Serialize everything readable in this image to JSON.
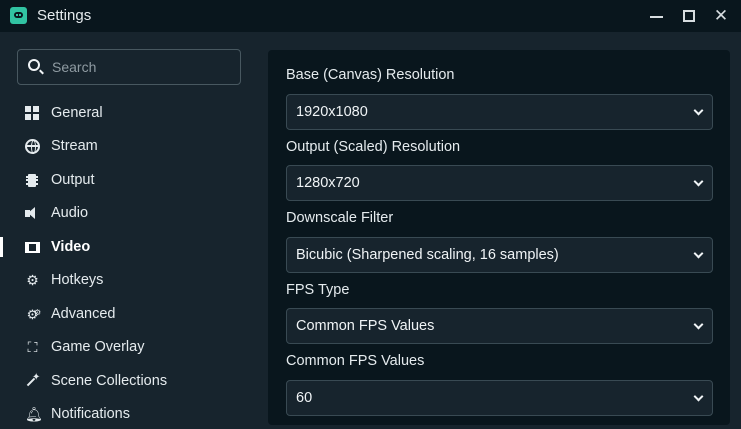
{
  "window": {
    "title": "Settings",
    "app_icon": "streamlabs-icon",
    "controls": [
      "minimize-icon",
      "maximize-icon",
      "close-icon"
    ]
  },
  "sidebar": {
    "search": {
      "placeholder": "Search",
      "value": ""
    },
    "items": [
      {
        "label": "General",
        "icon": "grid-icon",
        "active": false
      },
      {
        "label": "Stream",
        "icon": "globe-icon",
        "active": false
      },
      {
        "label": "Output",
        "icon": "chip-icon",
        "active": false
      },
      {
        "label": "Audio",
        "icon": "speaker-icon",
        "active": false
      },
      {
        "label": "Video",
        "icon": "film-icon",
        "active": true
      },
      {
        "label": "Hotkeys",
        "icon": "gear-icon",
        "active": false
      },
      {
        "label": "Advanced",
        "icon": "gears-icon",
        "active": false
      },
      {
        "label": "Game Overlay",
        "icon": "overlay-icon",
        "active": false
      },
      {
        "label": "Scene Collections",
        "icon": "wand-icon",
        "active": false
      },
      {
        "label": "Notifications",
        "icon": "bell-icon",
        "active": false
      }
    ]
  },
  "video": {
    "fields": [
      {
        "label": "Base (Canvas) Resolution",
        "value": "1920x1080"
      },
      {
        "label": "Output (Scaled) Resolution",
        "value": "1280x720"
      },
      {
        "label": "Downscale Filter",
        "value": "Bicubic (Sharpened scaling, 16 samples)"
      },
      {
        "label": "FPS Type",
        "value": "Common FPS Values"
      },
      {
        "label": "Common FPS Values",
        "value": "60"
      }
    ]
  },
  "colors": {
    "background": "#17242d",
    "panel": "#09161d",
    "accent": "#31c3a2",
    "text": "#f0f4f6"
  }
}
